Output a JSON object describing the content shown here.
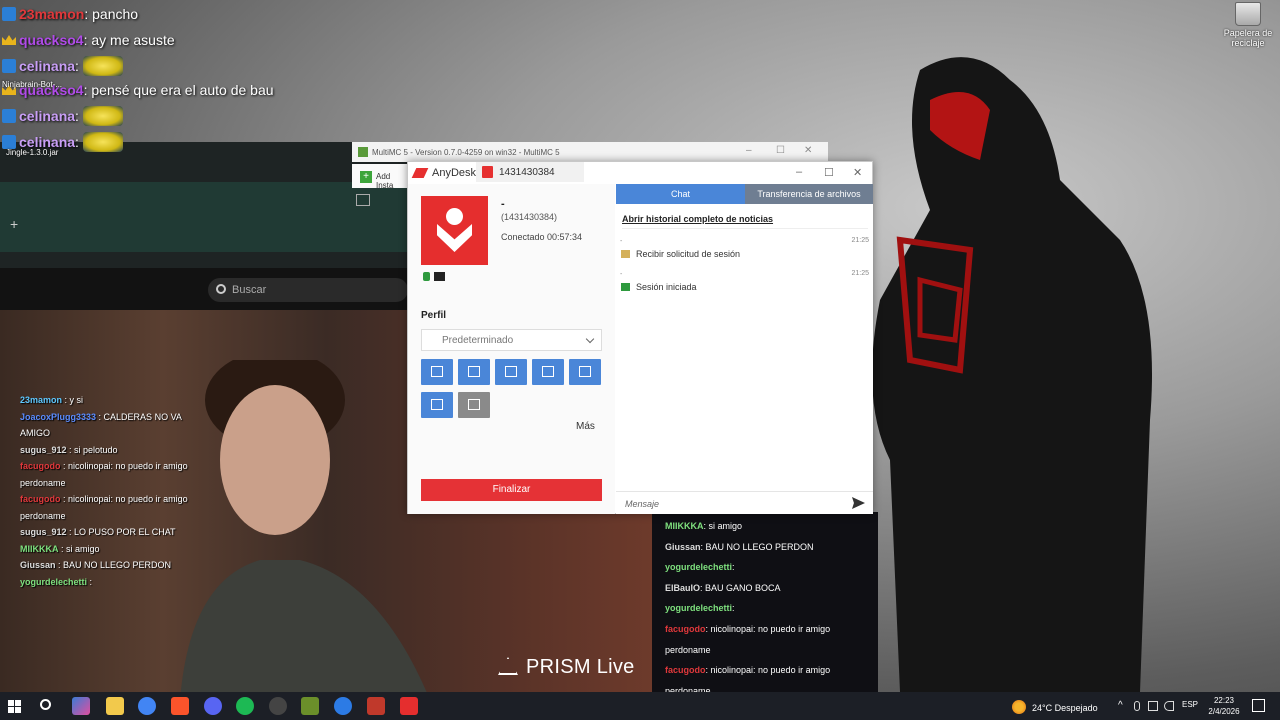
{
  "desktop": {
    "recycle_bin_label": "Papelera de reciclaje",
    "icon_labels": [
      "Ninjabrain-Bot-...",
      "Jingle-1.3.0.jar"
    ]
  },
  "top_chat": [
    {
      "user": "23mamon",
      "msg": ": pancho",
      "color": "#e0383b"
    },
    {
      "user": "quackso4",
      "msg": ": ay me asuste",
      "color": "#b04be8"
    },
    {
      "user": "celinana",
      "msg": ":",
      "color": "#c89ef5",
      "emote": true
    },
    {
      "user": "quackso4",
      "msg": ": pensé que era el auto de bau",
      "color": "#b04be8"
    },
    {
      "user": "celinana",
      "msg": ":",
      "color": "#c89ef5",
      "emote": true
    },
    {
      "user": "celinana",
      "msg": ":",
      "color": "#c89ef5",
      "emote": true
    }
  ],
  "multimc": {
    "title": "MultiMC 5 - Version 0.7.0-4259 on win32 - MultiMC 5",
    "add_instance": "Add Insta",
    "search_placeholder": "Buscar"
  },
  "cam_chat": [
    {
      "user": "23mamon",
      "msg": " : y si",
      "color": "#5ec8ff"
    },
    {
      "user": "JoacoxPlugg3333",
      "msg": " : CALDERAS NO VA AMIGO",
      "color": "#5a8cff"
    },
    {
      "user": "sugus_912",
      "msg": " : si pelotudo",
      "color": "#dddddd"
    },
    {
      "user": "facugodo",
      "msg": " : nicolinopai: no puedo ir amigo perdoname",
      "color": "#e0383b"
    },
    {
      "user": "facugodo",
      "msg": " : nicolinopai: no puedo ir amigo perdoname",
      "color": "#e0383b"
    },
    {
      "user": "sugus_912",
      "msg": " : LO PUSO POR EL CHAT",
      "color": "#dddddd"
    },
    {
      "user": "MIIKKKA",
      "msg": " : si amigo",
      "color": "#7ee07e"
    },
    {
      "user": "Giussan",
      "msg": " : BAU NO LLEGO PERDON",
      "color": "#dddddd"
    },
    {
      "user": "yogurdelechetti",
      "msg": " :",
      "color": "#7ee07e"
    }
  ],
  "prism": {
    "label": "PRISM Live"
  },
  "right_chat": [
    {
      "user": "MIIKKKA",
      "msg": ": si amigo",
      "color": "#7ee07e"
    },
    {
      "user": "Giussan",
      "msg": ": BAU NO LLEGO PERDON",
      "color": "#dddddd"
    },
    {
      "user": "yogurdelechetti",
      "msg": ":",
      "color": "#7ee07e"
    },
    {
      "user": "ElBauIO",
      "msg": ": BAU GANO BOCA",
      "color": "#dddddd"
    },
    {
      "user": "yogurdelechetti",
      "msg": ":",
      "color": "#7ee07e"
    },
    {
      "user": "facugodo",
      "msg": ": nicolinopai: no puedo ir amigo perdoname",
      "color": "#e0383b"
    },
    {
      "user": "facugodo",
      "msg": ": nicolinopai: no puedo ir amigo perdoname",
      "color": "#e0383b"
    }
  ],
  "anydesk": {
    "app_name": "AnyDesk",
    "tab_id": "1431430384",
    "peer_name": "-",
    "peer_id": "(1431430384)",
    "connected": "Conectado 00:57:34",
    "perfil_label": "Perfil",
    "perfil_value": "Predeterminado",
    "mas_label": "Más",
    "finalizar_label": "Finalizar",
    "tab_chat": "Chat",
    "tab_files": "Transferencia de archivos",
    "history_link": "Abrir historial completo de noticias",
    "events": [
      {
        "dot": "-",
        "time": "21:25",
        "text": "Recibir solicitud de sesión"
      },
      {
        "dot": "-",
        "time": "21:25",
        "text": "Sesión iniciada"
      }
    ],
    "message_placeholder": "Mensaje",
    "accent": "#e52e2e",
    "tab_color": "#4a86d8"
  },
  "taskbar": {
    "weather": "24°C  Despejado",
    "lang": "ESP",
    "time": "22:23",
    "date": "2/4/2026"
  }
}
